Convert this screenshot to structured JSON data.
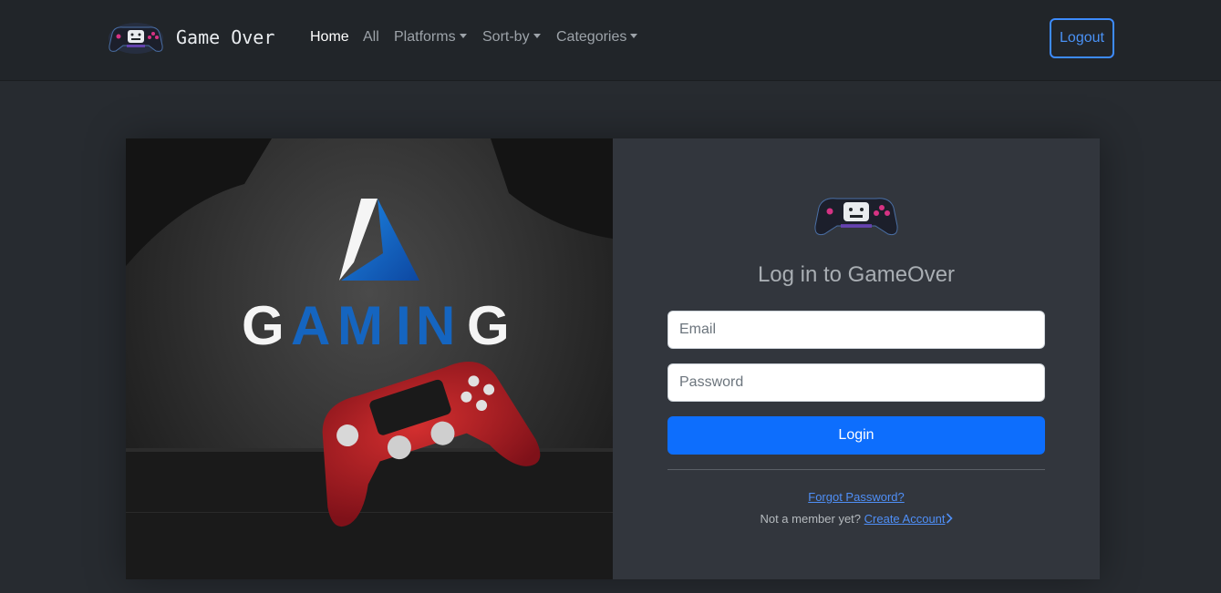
{
  "navbar": {
    "brand_text": "Game Over",
    "links": [
      {
        "label": "Home",
        "active": true
      },
      {
        "label": "All"
      },
      {
        "label": "Platforms",
        "dropdown": true
      },
      {
        "label": "Sort-by",
        "dropdown": true
      },
      {
        "label": "Categories",
        "dropdown": true
      }
    ],
    "logout_label": "Logout"
  },
  "hero": {
    "word": "GAMING",
    "letters": [
      "G",
      "A",
      "M",
      "I",
      "N",
      "G"
    ],
    "controller_color": "#b2202a"
  },
  "login": {
    "title": "Log in to GameOver",
    "email_placeholder": "Email",
    "password_placeholder": "Password",
    "login_label": "Login",
    "forgot_label": "Forgot Password?",
    "not_member_text": "Not a member yet?",
    "create_label": "Create Account"
  },
  "colors": {
    "navbar_bg": "#212529",
    "page_bg": "#272b30",
    "panel_bg": "#32363d",
    "primary": "#0d6efd",
    "logo_blue": "#1565c0"
  },
  "icons": {
    "brand": "gamepad-logo-icon",
    "dropdown": "caret-down-icon",
    "create": "chevron-right-icon"
  }
}
